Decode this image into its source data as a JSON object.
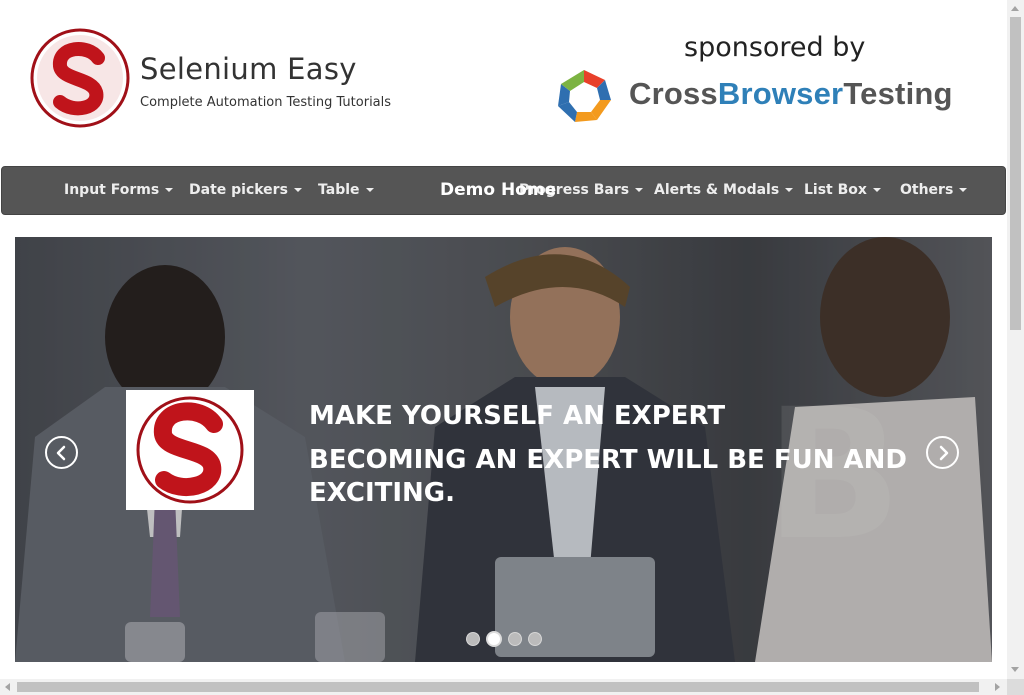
{
  "brand": {
    "title": "Selenium Easy",
    "subtitle": "Complete Automation Testing Tutorials",
    "logo_letter": "S"
  },
  "sponsor": {
    "label": "sponsored by",
    "name_part1": "Cross",
    "name_part2": "Browser",
    "name_part3": "Testing"
  },
  "nav": {
    "items": [
      {
        "label": "Input Forms"
      },
      {
        "label": "Date pickers"
      },
      {
        "label": "Table"
      },
      {
        "label": "Progress Bars"
      },
      {
        "label": "Alerts & Modals"
      },
      {
        "label": "List Box"
      },
      {
        "label": "Others"
      }
    ],
    "home_label": "Demo Home"
  },
  "carousel": {
    "headline_1": "MAKE YOURSELF AN EXPERT",
    "headline_2": "BECOMING AN EXPERT WILL BE FUN AND EXCITING.",
    "slide_count": 4,
    "active_slide": 2
  },
  "colors": {
    "navbar_bg": "#555555",
    "brand_red": "#c0141b",
    "cbt_blue": "#2f80b8"
  }
}
